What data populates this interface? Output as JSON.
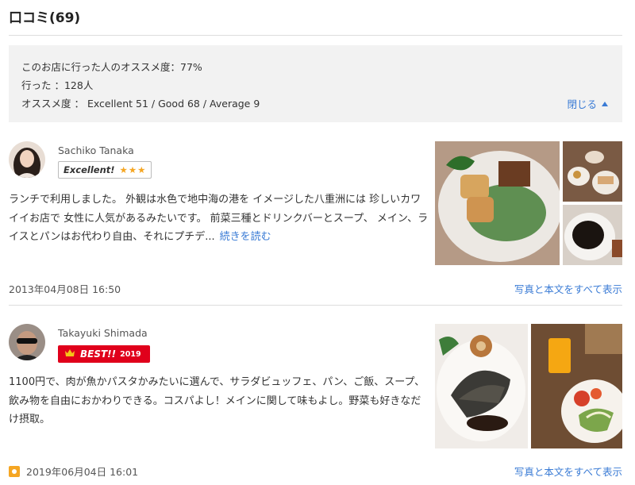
{
  "header": {
    "title": "口コミ(69)"
  },
  "summary": {
    "recommend": "このお店に行った人のオススメ度：77%",
    "visited": "行った ：128人",
    "breakdown": "オススメ度 ： Excellent 51 / Good 68 / Average 9",
    "close_label": "閉じる"
  },
  "reviews": [
    {
      "user": "Sachiko Tanaka",
      "badge": "Excellent!",
      "stars": "★★★",
      "text": "ランチで利用しました。 外観は水色で地中海の港を イメージした八重洲には 珍しいカワイイお店で 女性に人気があるみたいです。 前菜三種とドリンクバーとスープ、 メイン、ライスとパンはお代わり自由、それにプチデ...",
      "read_more": "続きを読む",
      "date": "2013年04月08日 16:50",
      "show_all": "写真と本文をすべて表示"
    },
    {
      "user": "Takayuki Shimada",
      "badge": "BEST!!",
      "badge_year": "2019",
      "text": "1100円で、肉が魚かパスタかみたいに選んで、サラダビュッフェ、パン、ご飯、スープ、飲み物を自由におかわりできる。コスパよし！メインに関して味もよし。野菜も好きなだけ摂取。",
      "date": "2019年06月04日 16:01",
      "show_all": "写真と本文をすべて表示"
    }
  ]
}
